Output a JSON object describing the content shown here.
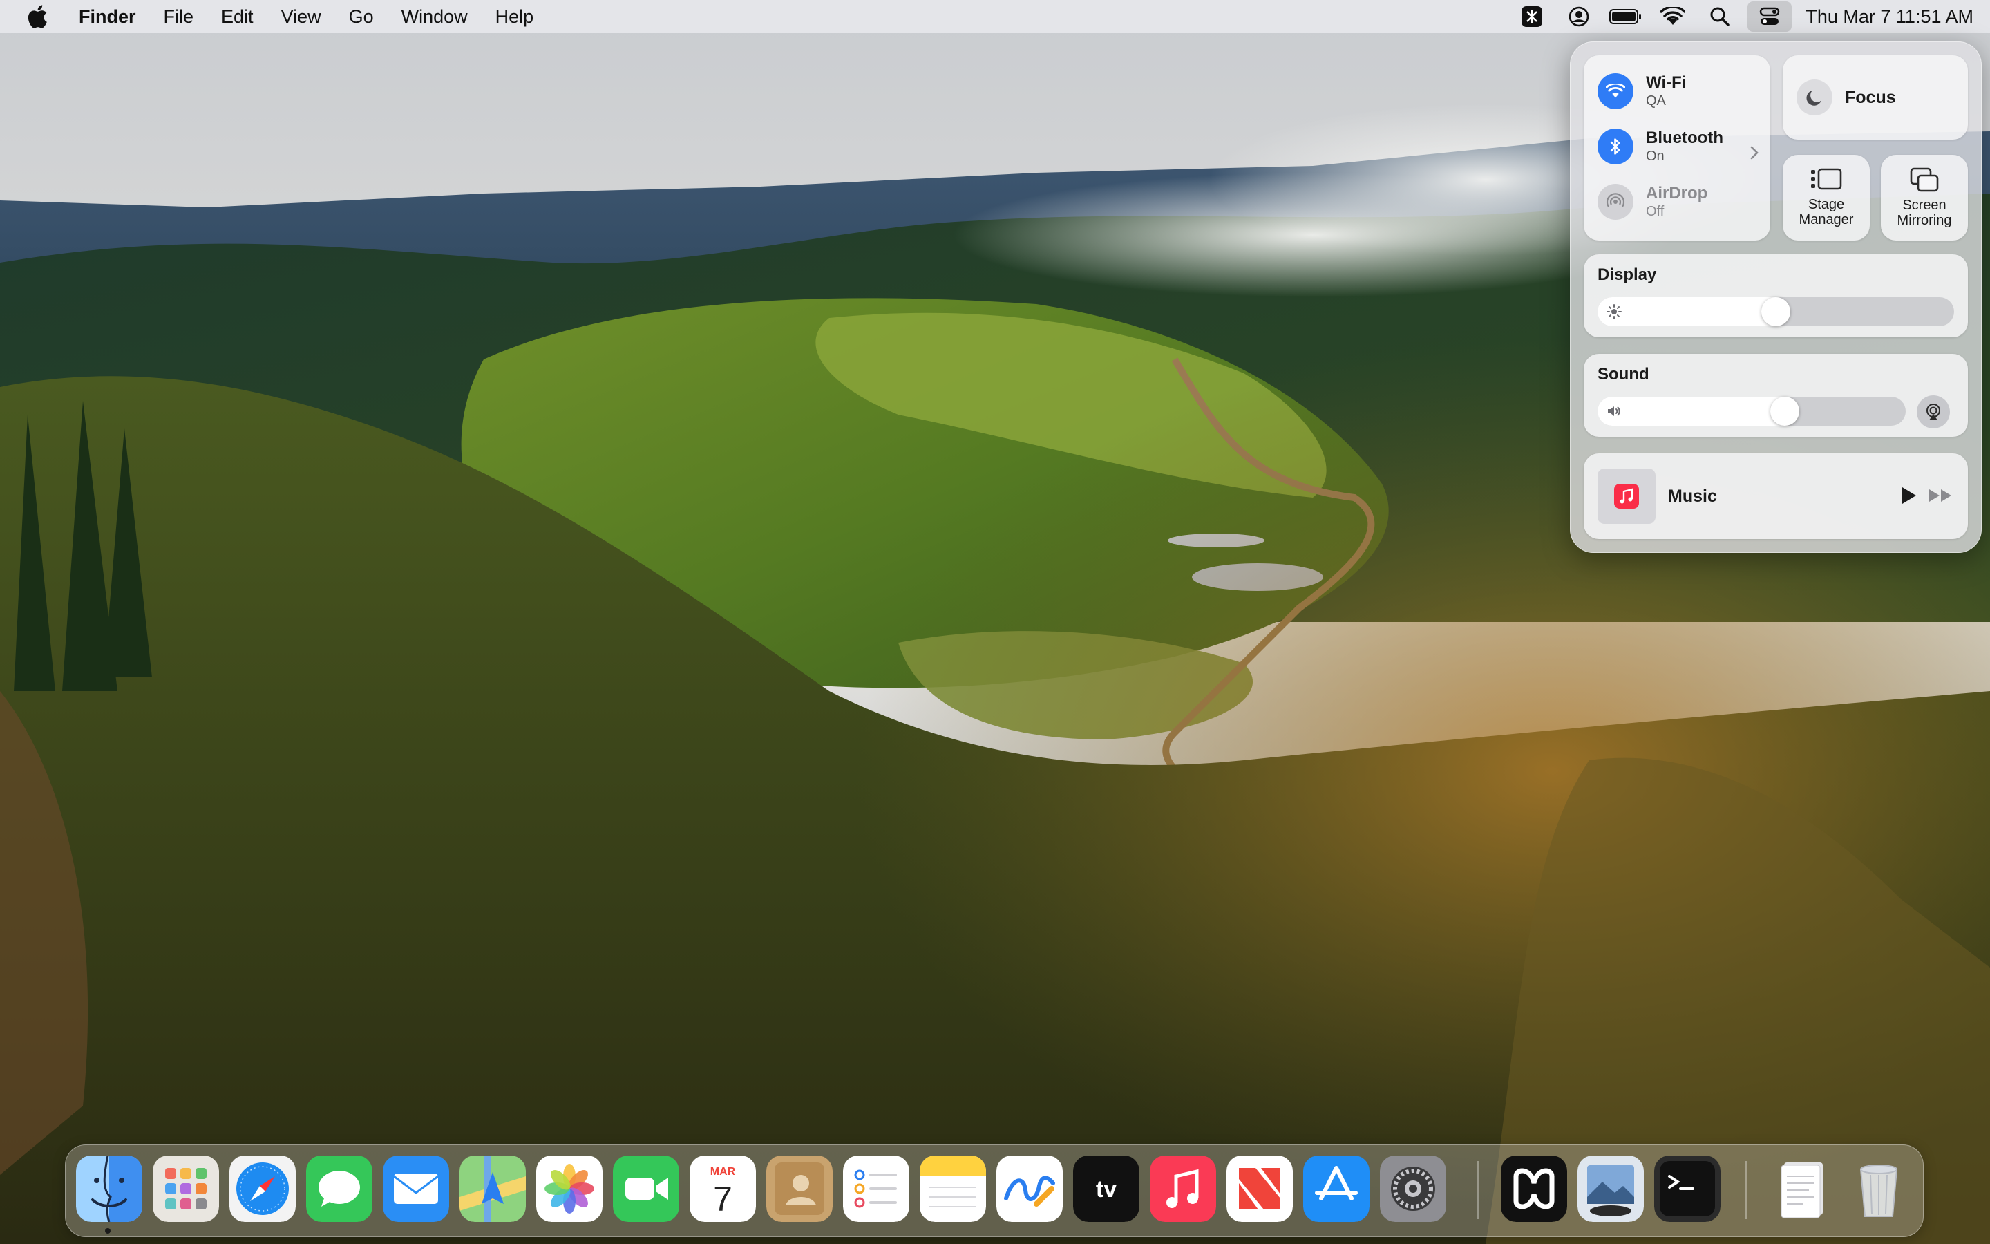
{
  "menubar": {
    "app_name": "Finder",
    "menus": [
      "File",
      "Edit",
      "View",
      "Go",
      "Window",
      "Help"
    ],
    "status_icons": [
      "perplexity-icon",
      "user-account-icon",
      "battery-icon",
      "wifi-icon",
      "search-icon",
      "control-center-icon"
    ],
    "clock": "Thu Mar 7  11:51 AM"
  },
  "control_center": {
    "wifi": {
      "title": "Wi-Fi",
      "subtitle": "QA"
    },
    "bluetooth": {
      "title": "Bluetooth",
      "subtitle": "On"
    },
    "airdrop": {
      "title": "AirDrop",
      "subtitle": "Off"
    },
    "focus": {
      "label": "Focus"
    },
    "stage_manager": {
      "line1": "Stage",
      "line2": "Manager"
    },
    "screen_mirroring": {
      "line1": "Screen",
      "line2": "Mirroring"
    },
    "display": {
      "title": "Display",
      "level": 0.5
    },
    "sound": {
      "title": "Sound",
      "level": 0.62
    },
    "now_playing": {
      "label": "Music"
    },
    "colors": {
      "accent_blue": "#2f7cf6",
      "music_red": "#fa2d48"
    }
  },
  "dock": {
    "apps": [
      "Finder",
      "Launchpad",
      "Safari",
      "Messages",
      "Mail",
      "Maps",
      "Photos",
      "FaceTime",
      "Calendar",
      "Contacts",
      "Reminders",
      "Notes",
      "Freeform",
      "TV",
      "Music",
      "News",
      "App Store",
      "System Settings",
      "Perplexity",
      "Preview",
      "Terminal",
      "Documents",
      "Trash"
    ],
    "calendar": {
      "month": "MAR",
      "day": "7"
    }
  }
}
